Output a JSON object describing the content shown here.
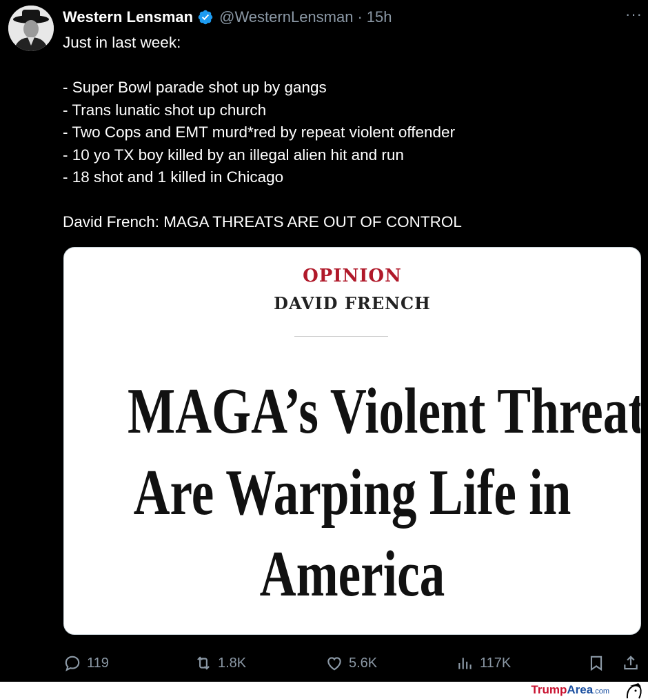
{
  "tweet": {
    "author_name": "Western Lensman",
    "author_handle": "@WesternLensman",
    "separator": "·",
    "time": "15h",
    "more_label": "···",
    "lines": [
      "Just in last week:",
      "",
      "- Super Bowl parade shot up by gangs",
      "- Trans lunatic shot up church",
      "- Two Cops and EMT murd*red by repeat violent offender",
      "- 10 yo TX boy killed by an illegal alien hit and run",
      "- 18 shot and 1 killed in Chicago",
      "",
      "David French: MAGA THREATS ARE OUT OF CONTROL"
    ]
  },
  "card": {
    "kicker": "OPINION",
    "author": "DAVID FRENCH",
    "headline": [
      "MAGA’s Violent Threats",
      "Are Warping Life in",
      "America"
    ]
  },
  "actions": {
    "replies": "119",
    "reposts": "1.8K",
    "likes": "5.6K",
    "views": "117K"
  },
  "watermark": {
    "part1": "Trump",
    "part2": "Area",
    "part3": ".com"
  },
  "colors": {
    "background": "#000000",
    "text": "#ffffff",
    "muted": "#8b98a5",
    "verified": "#1d9bf0",
    "opinion_red": "#b0192a"
  },
  "icons": [
    "verified-badge-icon",
    "more-icon",
    "reply-icon",
    "repost-icon",
    "like-icon",
    "views-icon",
    "bookmark-icon",
    "share-icon"
  ]
}
